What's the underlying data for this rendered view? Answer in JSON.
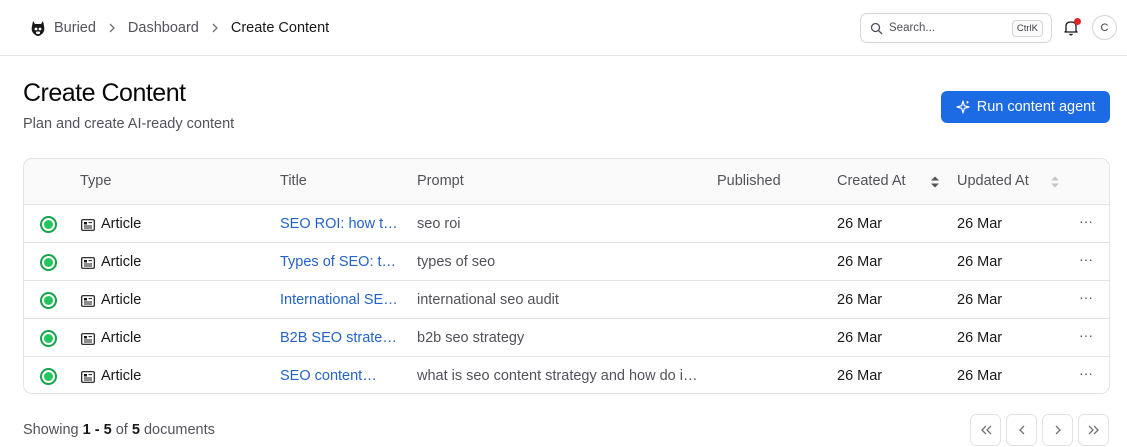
{
  "topbar": {
    "breadcrumbs": [
      "Buried",
      "Dashboard",
      "Create Content"
    ],
    "search_placeholder": "Search...",
    "search_shortcut": "CtrlK",
    "avatar_initial": "C"
  },
  "header": {
    "title": "Create Content",
    "subtitle": "Plan and create AI-ready content",
    "agent_button_label": "Run content agent"
  },
  "table": {
    "columns": [
      "Type",
      "Title",
      "Prompt",
      "Published",
      "Created At",
      "Updated At"
    ],
    "rows": [
      {
        "type": "Article",
        "title": "SEO ROI: how to…",
        "prompt": "seo roi",
        "published": "",
        "created": "26 Mar",
        "updated": "26 Mar"
      },
      {
        "type": "Article",
        "title": "Types of SEO: th…",
        "prompt": "types of seo",
        "published": "",
        "created": "26 Mar",
        "updated": "26 Mar"
      },
      {
        "type": "Article",
        "title": "International SEO…",
        "prompt": "international seo audit",
        "published": "",
        "created": "26 Mar",
        "updated": "26 Mar"
      },
      {
        "type": "Article",
        "title": "B2B SEO strateg…",
        "prompt": "b2b seo strategy",
        "published": "",
        "created": "26 Mar",
        "updated": "26 Mar"
      },
      {
        "type": "Article",
        "title": "SEO content…",
        "prompt": "what is seo content strategy and how do i …",
        "published": "",
        "created": "26 Mar",
        "updated": "26 Mar"
      }
    ],
    "row_menu_glyph": "···"
  },
  "footer": {
    "showing_label": "Showing",
    "range_start": "1",
    "range_sep": " - ",
    "range_end": "5",
    "of_label": "of",
    "total": "5",
    "unit_label": "documents"
  },
  "colors": {
    "accent": "#1d6ae5",
    "link": "#2563c9",
    "status_ok": "#22c55e",
    "notification": "#dc2626"
  },
  "icons": {
    "logo": "buried-logo-icon",
    "breadcrumb_separator": "chevron-right-icon",
    "search": "search-icon",
    "notifications": "bell-icon",
    "agent": "sparkle-icon",
    "type": "article-icon",
    "status": "status-published-icon",
    "sort": "sort-icon",
    "row_menu": "more-horizontal-icon",
    "pager": [
      "chevrons-left-icon",
      "chevron-left-icon",
      "chevron-right-icon",
      "chevrons-right-icon"
    ]
  }
}
